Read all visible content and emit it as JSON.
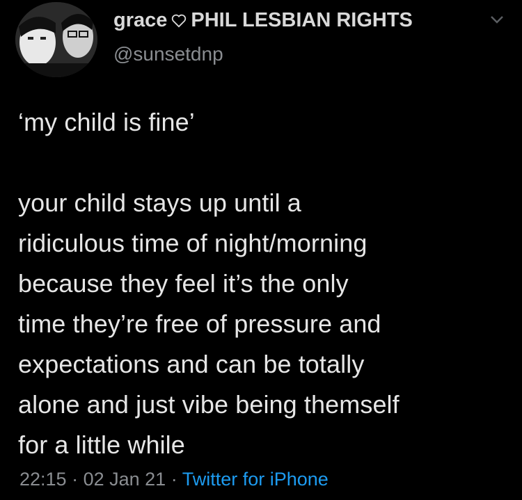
{
  "user": {
    "display_name": "grace",
    "display_suffix": "PHIL LESBIAN RIGHTS",
    "handle": "@sunsetdnp",
    "heart_icon": "heart-outline-icon",
    "menu_icon": "chevron-down-icon"
  },
  "tweet": {
    "text": "‘my child is fine’\n\nyour child stays up until a\nridiculous time of night/morning\nbecause they feel it’s the only\ntime they’re free of pressure and\nexpectations and can be totally\nalone and just vibe being themself\nfor a little while"
  },
  "meta": {
    "time": "22:15",
    "separator": " · ",
    "date": "02 Jan 21",
    "separator2": " · ",
    "source": "Twitter for iPhone"
  },
  "colors": {
    "background": "#000000",
    "text": "#e6e6e6",
    "secondary": "#8a8d91",
    "link": "#1d9bf0"
  }
}
